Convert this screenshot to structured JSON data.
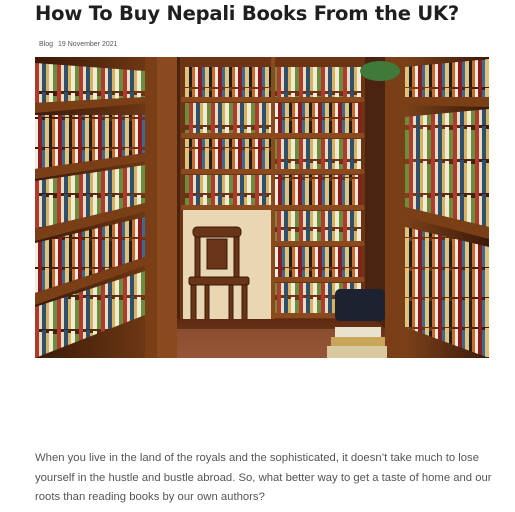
{
  "post": {
    "title": "How To Buy Nepali Books From the UK?",
    "category": "Blog",
    "date": "19 November 2021",
    "featured_image": {
      "subject": "bookshop-interior-with-wooden-chair"
    },
    "excerpt": "When you live in the land of the royals and the sophisticated, it doesn’t take much to lose yourself in the hustle and bustle abroad. So, what better way to get a taste of home and our roots than reading books by our own authors?"
  },
  "colors": {
    "title": "#1f1f1f",
    "meta": "#555555",
    "body_text": "#555555",
    "shelf_wood": "#7a3f17"
  }
}
